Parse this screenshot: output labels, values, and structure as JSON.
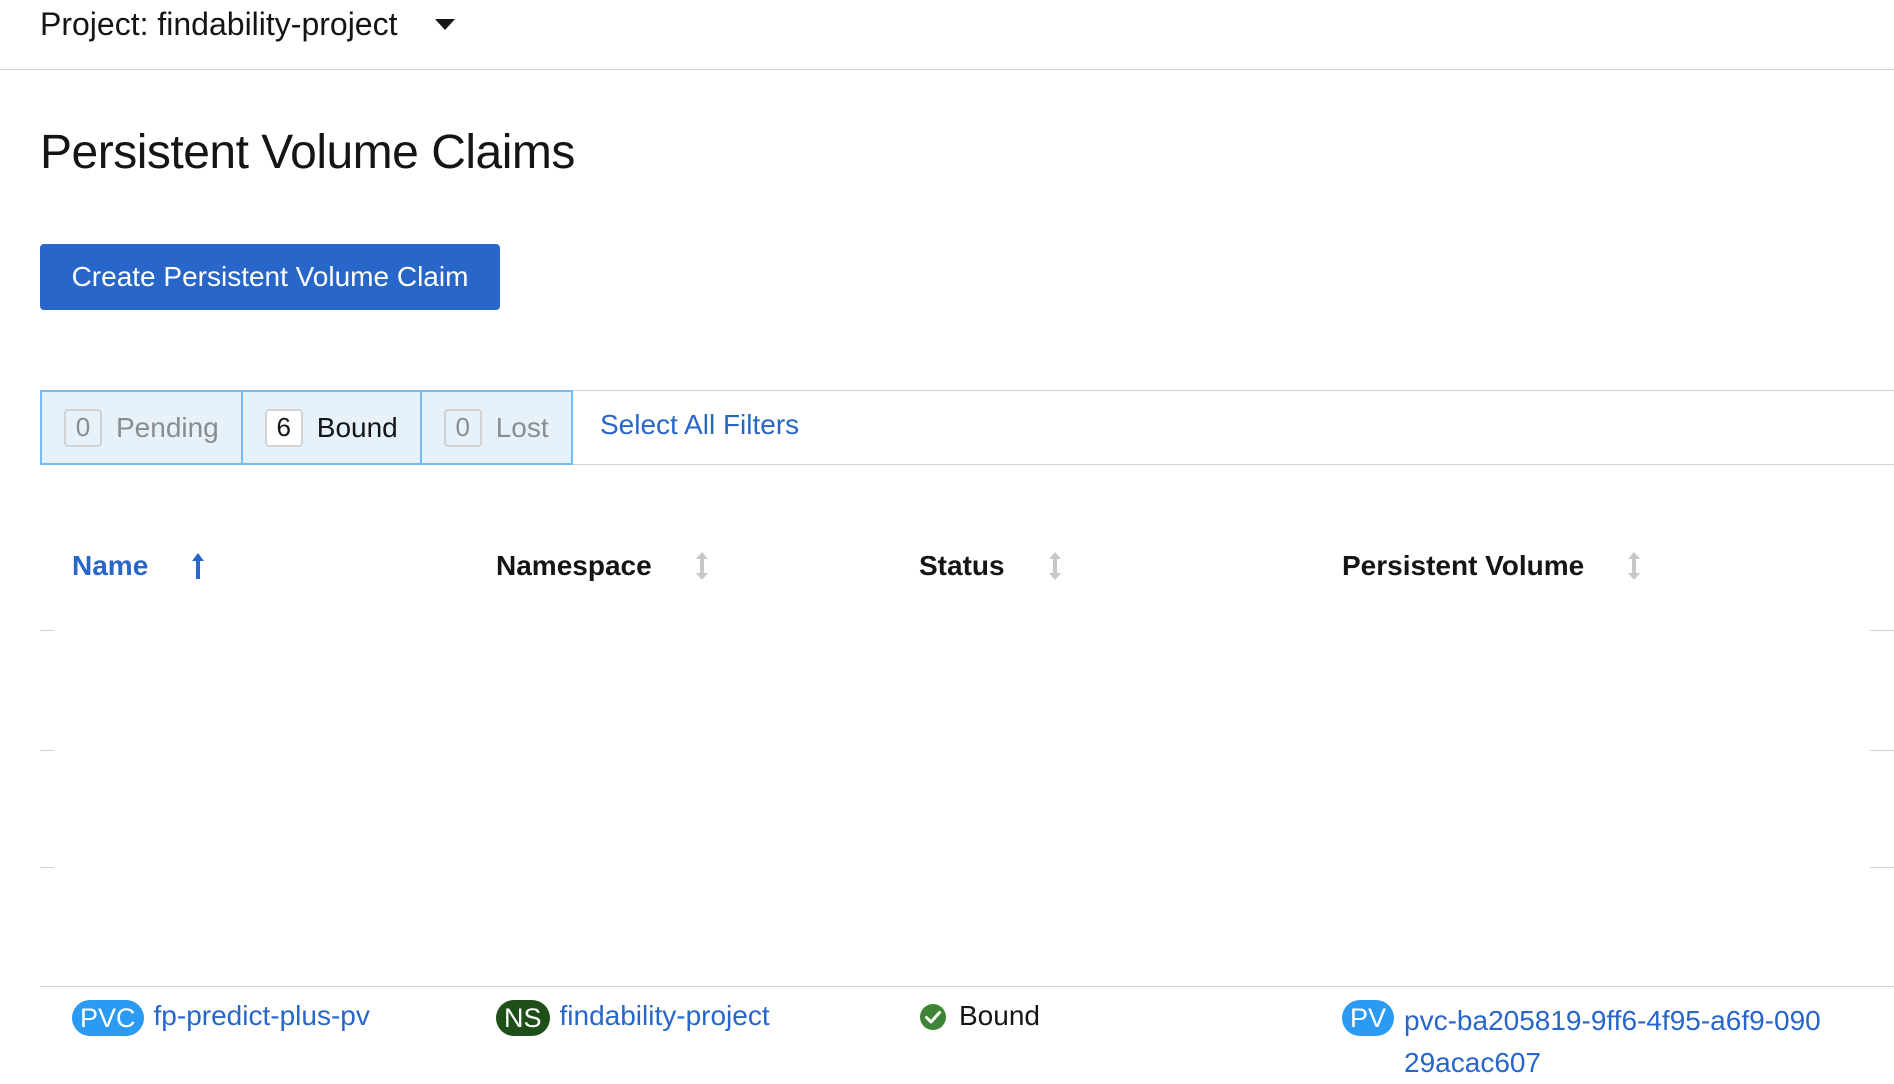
{
  "header": {
    "project_label": "Project: findability-project"
  },
  "page": {
    "title": "Persistent Volume Claims",
    "create_button_label": "Create Persistent Volume Claim"
  },
  "filters": {
    "items": [
      {
        "count": "0",
        "label": "Pending",
        "active": false
      },
      {
        "count": "6",
        "label": "Bound",
        "active": true
      },
      {
        "count": "0",
        "label": "Lost",
        "active": false
      }
    ],
    "select_all_label": "Select All Filters"
  },
  "table": {
    "columns": [
      {
        "label": "Name",
        "sort": "ascending"
      },
      {
        "label": "Namespace",
        "sort": "none"
      },
      {
        "label": "Status",
        "sort": "none"
      },
      {
        "label": "Persistent Volume",
        "sort": "none"
      }
    ],
    "rows": [
      {
        "name_badge": "PVC",
        "name": "fp-predict-plus-pv",
        "namespace_badge": "NS",
        "namespace": "findability-project",
        "status": "Bound",
        "pv_badge": "PV",
        "persistent_volume": "pvc-ba205819-9ff6-4f95-a6f9-09029acac607"
      }
    ]
  },
  "colors": {
    "primary": "#2866c9",
    "badge_blue": "#2b9af3",
    "badge_ns": "#1e4f18",
    "success": "#3e8635",
    "filter_bg": "#e7f1fa",
    "filter_border": "#73bcf7"
  },
  "icons": {
    "project_caret": "caret-down-icon",
    "sort_ascending": "arrow-up-icon",
    "sort_none": "sort-icon",
    "status_ok": "check-circle-icon"
  }
}
